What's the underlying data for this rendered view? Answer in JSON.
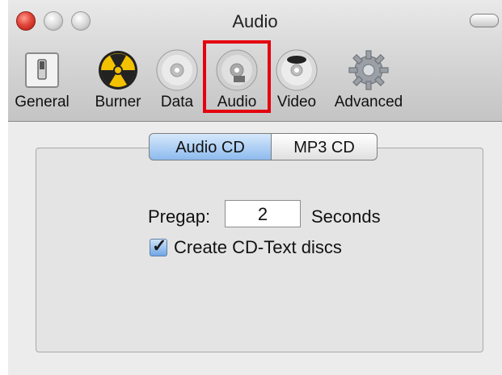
{
  "window": {
    "title": "Audio"
  },
  "toolbar": {
    "items": [
      {
        "label": "General",
        "icon": "switch-icon"
      },
      {
        "label": "Burner",
        "icon": "radiation-icon"
      },
      {
        "label": "Data",
        "icon": "data-disc-icon"
      },
      {
        "label": "Audio",
        "icon": "audio-disc-icon",
        "selected": true
      },
      {
        "label": "Video",
        "icon": "dvd-disc-icon"
      },
      {
        "label": "Advanced",
        "icon": "gear-icon"
      }
    ],
    "highlight_color": "#e4000f"
  },
  "tabs": {
    "items": [
      {
        "label": "Audio CD",
        "selected": true
      },
      {
        "label": "MP3 CD",
        "selected": false
      }
    ]
  },
  "form": {
    "pregap_label": "Pregap:",
    "pregap_value": "2",
    "seconds_label": "Seconds",
    "cdtext_label": "Create CD-Text discs",
    "cdtext_checked": true
  }
}
